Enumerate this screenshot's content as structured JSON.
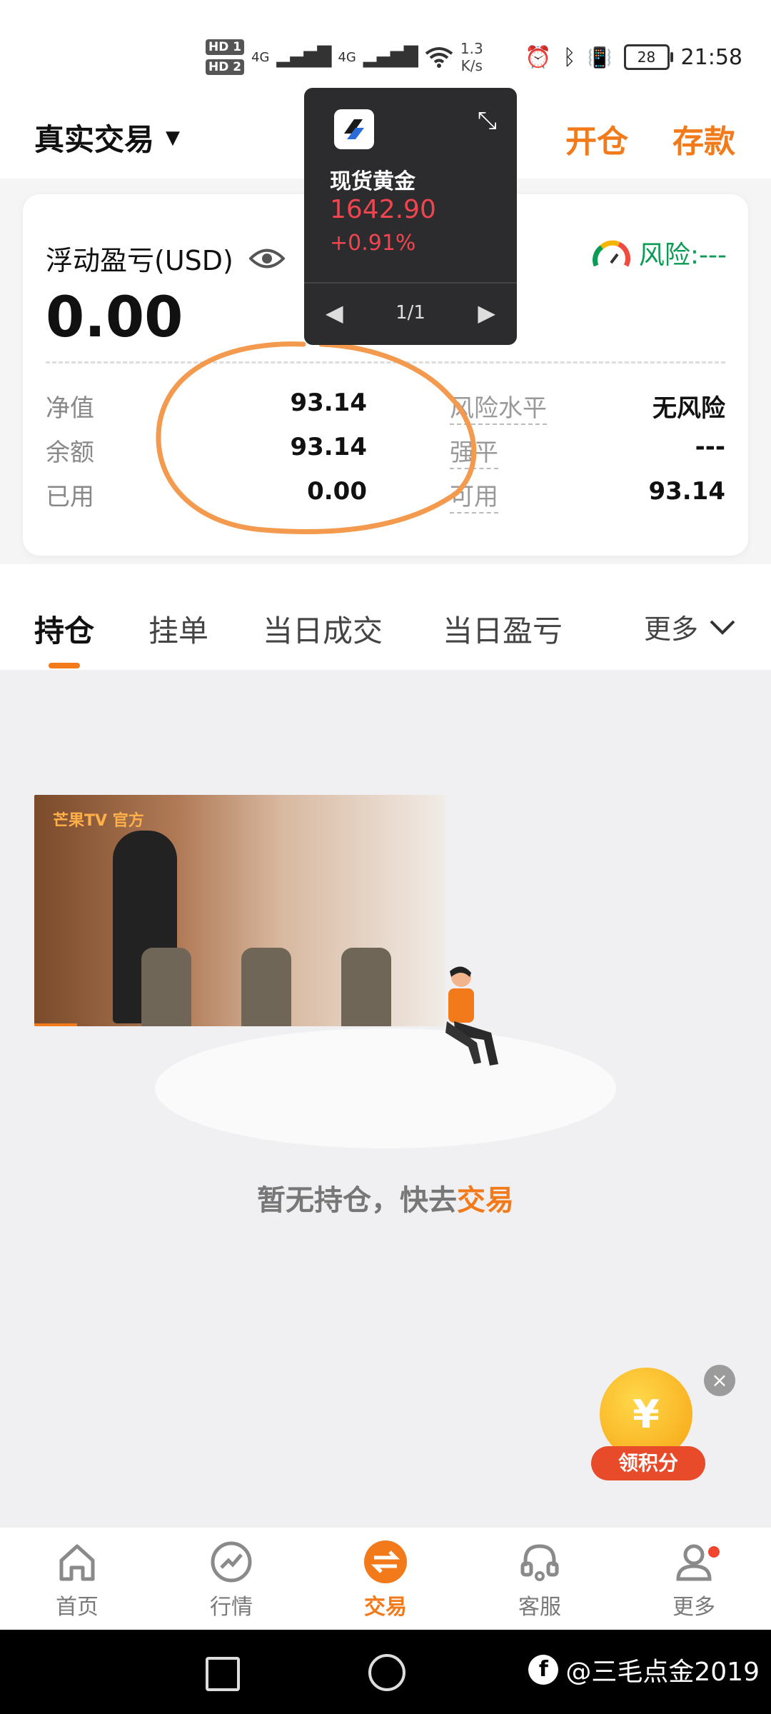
{
  "status_bar": {
    "hd1": "HD 1",
    "hd2": "HD 2",
    "signal1": "4G",
    "signal2": "4G",
    "net_speed_value": "1.3",
    "net_speed_unit": "K/s",
    "battery": "28",
    "time": "21:58"
  },
  "header": {
    "account_label": "真实交易",
    "open_label": "开仓",
    "deposit_label": "存款"
  },
  "summary": {
    "floating_pl_label": "浮动盈亏(USD)",
    "floating_pl_value": "0.00",
    "risk_label": "风险:---",
    "rows": [
      {
        "k1": "净值",
        "v1": "93.14",
        "k2": "风险水平",
        "v2": "无风险"
      },
      {
        "k1": "余额",
        "v1": "93.14",
        "k2": "强平",
        "v2": "---"
      },
      {
        "k1": "已用",
        "v1": "0.00",
        "k2": "可用",
        "v2": "93.14"
      }
    ]
  },
  "quote_popup": {
    "name": "现货黄金",
    "price": "1642.90",
    "change": "+0.91%",
    "pager": "1/1"
  },
  "tabs": {
    "items": [
      "持仓",
      "挂单",
      "当日成交",
      "当日盈亏"
    ],
    "more_label": "更多"
  },
  "video": {
    "channel_logo": "芒果TV 官方"
  },
  "empty_state": {
    "text": "暂无持仓，快去",
    "action": "交易"
  },
  "reward": {
    "coin": "¥",
    "label": "领积分",
    "close": "×"
  },
  "bottom_nav": [
    {
      "label": "首页",
      "icon": "home-icon"
    },
    {
      "label": "行情",
      "icon": "chart-icon"
    },
    {
      "label": "交易",
      "icon": "exchange-icon"
    },
    {
      "label": "客服",
      "icon": "headset-icon"
    },
    {
      "label": "更多",
      "icon": "user-icon"
    }
  ],
  "watermark": {
    "text": "@三毛点金2019"
  },
  "colors": {
    "accent": "#f27a1a",
    "price_red": "#f0454f",
    "risk_green": "#0b9b55"
  }
}
